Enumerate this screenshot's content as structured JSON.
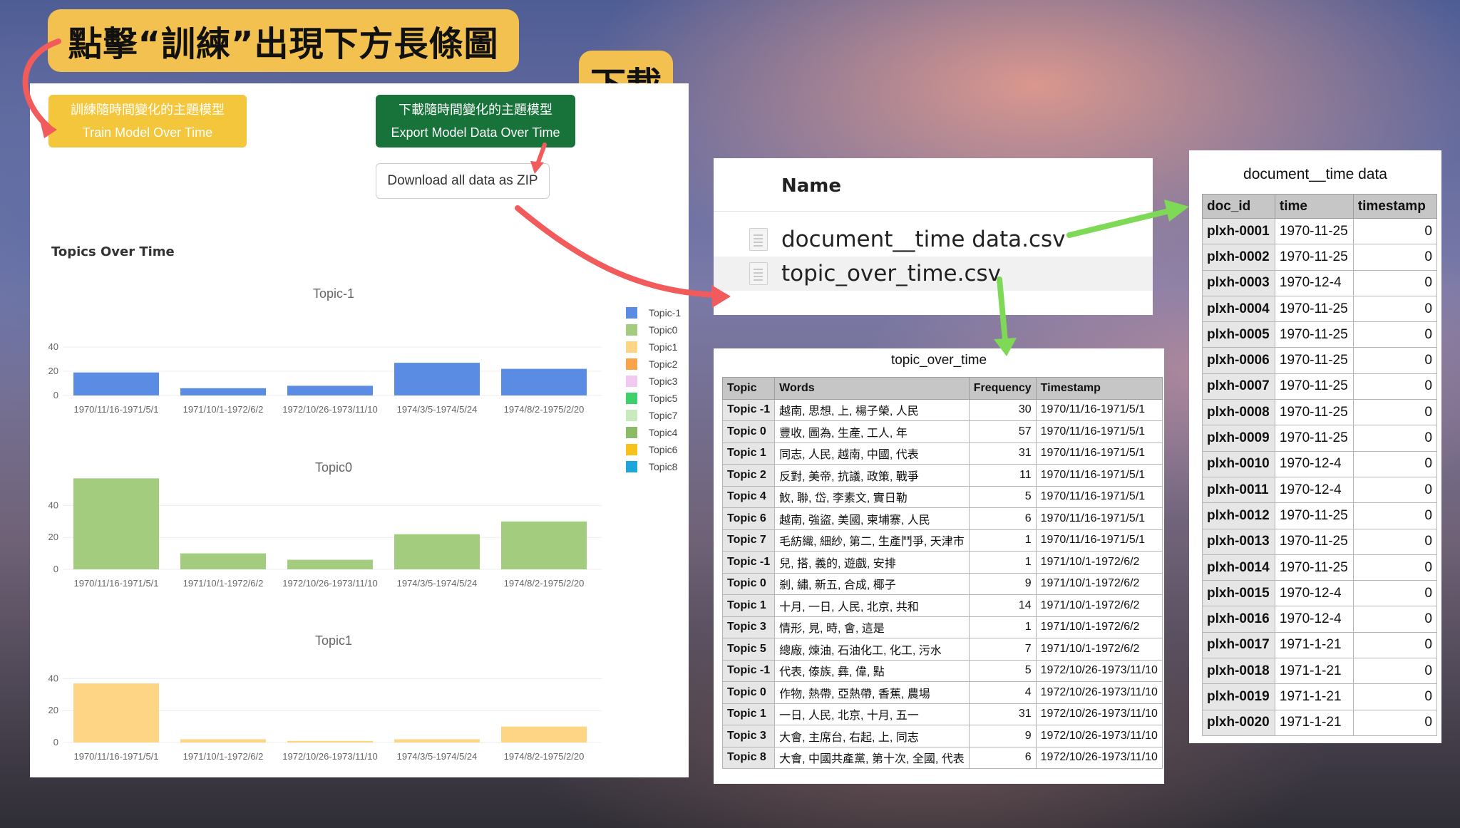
{
  "callouts": {
    "click_train": "點擊“訓練”出現下方長條圖",
    "download": "下載"
  },
  "buttons": {
    "train_zh": "訓練隨時間變化的主題模型",
    "train_en": "Train Model Over Time",
    "export_zh": "下載隨時間變化的主題模型",
    "export_en": "Export Model Data Over Time",
    "download_zip": "Download all data as ZIP"
  },
  "colors": {
    "callout": "#f3c14f",
    "train_button": "#f3c63c",
    "export_button": "#18733a",
    "arrow_red": "#f25b5b",
    "arrow_green": "#7ed957"
  },
  "charts_title": "Topics Over Time",
  "chart_data": [
    {
      "type": "bar",
      "title": "Topic-1",
      "categories": [
        "1970/11/16-1971/5/1",
        "1971/10/1-1972/6/2",
        "1972/10/26-1973/11/10",
        "1974/3/5-1974/5/24",
        "1974/8/2-1975/2/20"
      ],
      "values": [
        19,
        6,
        8,
        27,
        22
      ],
      "yticks": [
        0,
        20,
        40
      ],
      "ylim": [
        0,
        48
      ],
      "color": "#5b8ce3",
      "grid": true
    },
    {
      "type": "bar",
      "title": "Topic0",
      "categories": [
        "1970/11/16-1971/5/1",
        "1971/10/1-1972/6/2",
        "1972/10/26-1973/11/10",
        "1974/3/5-1974/5/24",
        "1974/8/2-1975/2/20"
      ],
      "values": [
        57,
        10,
        6,
        22,
        30
      ],
      "yticks": [
        0,
        20,
        40
      ],
      "ylim": [
        0,
        60
      ],
      "color": "#a3cc7f",
      "grid": true
    },
    {
      "type": "bar",
      "title": "Topic1",
      "categories": [
        "1970/11/16-1971/5/1",
        "1971/10/1-1972/6/2",
        "1972/10/26-1973/11/10",
        "1974/3/5-1974/5/24",
        "1974/8/2-1975/2/20"
      ],
      "values": [
        37,
        2,
        1,
        2,
        10
      ],
      "yticks": [
        0,
        20,
        40
      ],
      "ylim": [
        0,
        46
      ],
      "color": "#fdd584",
      "grid": true
    }
  ],
  "legend": {
    "placement": "right",
    "items": [
      {
        "label": "Topic-1",
        "color": "#5b8ce3"
      },
      {
        "label": "Topic0",
        "color": "#a3cc7f"
      },
      {
        "label": "Topic1",
        "color": "#fdd584"
      },
      {
        "label": "Topic2",
        "color": "#f9a44a"
      },
      {
        "label": "Topic3",
        "color": "#f2c9f1"
      },
      {
        "label": "Topic5",
        "color": "#3ed16b"
      },
      {
        "label": "Topic7",
        "color": "#c8eabd"
      },
      {
        "label": "Topic4",
        "color": "#8bbb67"
      },
      {
        "label": "Topic6",
        "color": "#f7c21a"
      },
      {
        "label": "Topic8",
        "color": "#1ba6dc"
      }
    ]
  },
  "file_list": {
    "header": "Name",
    "files": [
      {
        "name": "document__time data.csv",
        "icon": "document-icon"
      },
      {
        "name": "topic_over_time.csv",
        "icon": "document-icon"
      }
    ]
  },
  "topic_table": {
    "title": "topic_over_time",
    "columns": [
      "Topic",
      "Words",
      "Frequency",
      "Timestamp"
    ],
    "rows": [
      [
        "Topic -1",
        "越南, 思想, 上, 楊子榮, 人民",
        "30",
        "1970/11/16-1971/5/1"
      ],
      [
        "Topic 0",
        "豐收, 圖為, 生產, 工人, 年",
        "57",
        "1970/11/16-1971/5/1"
      ],
      [
        "Topic 1",
        "同志, 人民, 越南, 中國, 代表",
        "31",
        "1970/11/16-1971/5/1"
      ],
      [
        "Topic 2",
        "反對, 美帝, 抗議, 政策, 戰爭",
        "11",
        "1970/11/16-1971/5/1"
      ],
      [
        "Topic 4",
        "䰻, 聯, 岱, 李素文, 實日勒",
        "5",
        "1970/11/16-1971/5/1"
      ],
      [
        "Topic 6",
        "越南, 強盜, 美國, 柬埔寨, 人民",
        "6",
        "1970/11/16-1971/5/1"
      ],
      [
        "Topic 7",
        "毛紡織, 細紗, 第二, 生產鬥爭, 天津市",
        "1",
        "1970/11/16-1971/5/1"
      ],
      [
        "Topic -1",
        "兒, 搭, 義的, 遊戲, 安排",
        "1",
        "1971/10/1-1972/6/2"
      ],
      [
        "Topic 0",
        "剎, 繡, 新五, 合成, 椰子",
        "9",
        "1971/10/1-1972/6/2"
      ],
      [
        "Topic 1",
        "十月, 一日, 人民, 北京, 共和",
        "14",
        "1971/10/1-1972/6/2"
      ],
      [
        "Topic 3",
        "情形, 見, 時, 會, 這是",
        "1",
        "1971/10/1-1972/6/2"
      ],
      [
        "Topic 5",
        "總廠, 煉油, 石油化工, 化工, 污水",
        "7",
        "1971/10/1-1972/6/2"
      ],
      [
        "Topic -1",
        "代表, 傣族, 彝, 偉, 點",
        "5",
        "1972/10/26-1973/11/10"
      ],
      [
        "Topic 0",
        "作物, 熱帶, 亞熱帶, 香蕉, 農場",
        "4",
        "1972/10/26-1973/11/10"
      ],
      [
        "Topic 1",
        "一日, 人民, 北京, 十月, 五一",
        "31",
        "1972/10/26-1973/11/10"
      ],
      [
        "Topic 3",
        "大會, 主席台, 右起, 上, 同志",
        "9",
        "1972/10/26-1973/11/10"
      ],
      [
        "Topic 8",
        "大會, 中國共產黨, 第十次, 全國, 代表",
        "6",
        "1972/10/26-1973/11/10"
      ]
    ]
  },
  "doc_table": {
    "title": "document__time data",
    "columns": [
      "doc_id",
      "time",
      "timestamp"
    ],
    "rows": [
      [
        "plxh-0001",
        "1970-11-25",
        "0"
      ],
      [
        "plxh-0002",
        "1970-11-25",
        "0"
      ],
      [
        "plxh-0003",
        "1970-12-4",
        "0"
      ],
      [
        "plxh-0004",
        "1970-11-25",
        "0"
      ],
      [
        "plxh-0005",
        "1970-11-25",
        "0"
      ],
      [
        "plxh-0006",
        "1970-11-25",
        "0"
      ],
      [
        "plxh-0007",
        "1970-11-25",
        "0"
      ],
      [
        "plxh-0008",
        "1970-11-25",
        "0"
      ],
      [
        "plxh-0009",
        "1970-11-25",
        "0"
      ],
      [
        "plxh-0010",
        "1970-12-4",
        "0"
      ],
      [
        "plxh-0011",
        "1970-12-4",
        "0"
      ],
      [
        "plxh-0012",
        "1970-11-25",
        "0"
      ],
      [
        "plxh-0013",
        "1970-11-25",
        "0"
      ],
      [
        "plxh-0014",
        "1970-11-25",
        "0"
      ],
      [
        "plxh-0015",
        "1970-12-4",
        "0"
      ],
      [
        "plxh-0016",
        "1970-12-4",
        "0"
      ],
      [
        "plxh-0017",
        "1971-1-21",
        "0"
      ],
      [
        "plxh-0018",
        "1971-1-21",
        "0"
      ],
      [
        "plxh-0019",
        "1971-1-21",
        "0"
      ],
      [
        "plxh-0020",
        "1971-1-21",
        "0"
      ]
    ]
  }
}
